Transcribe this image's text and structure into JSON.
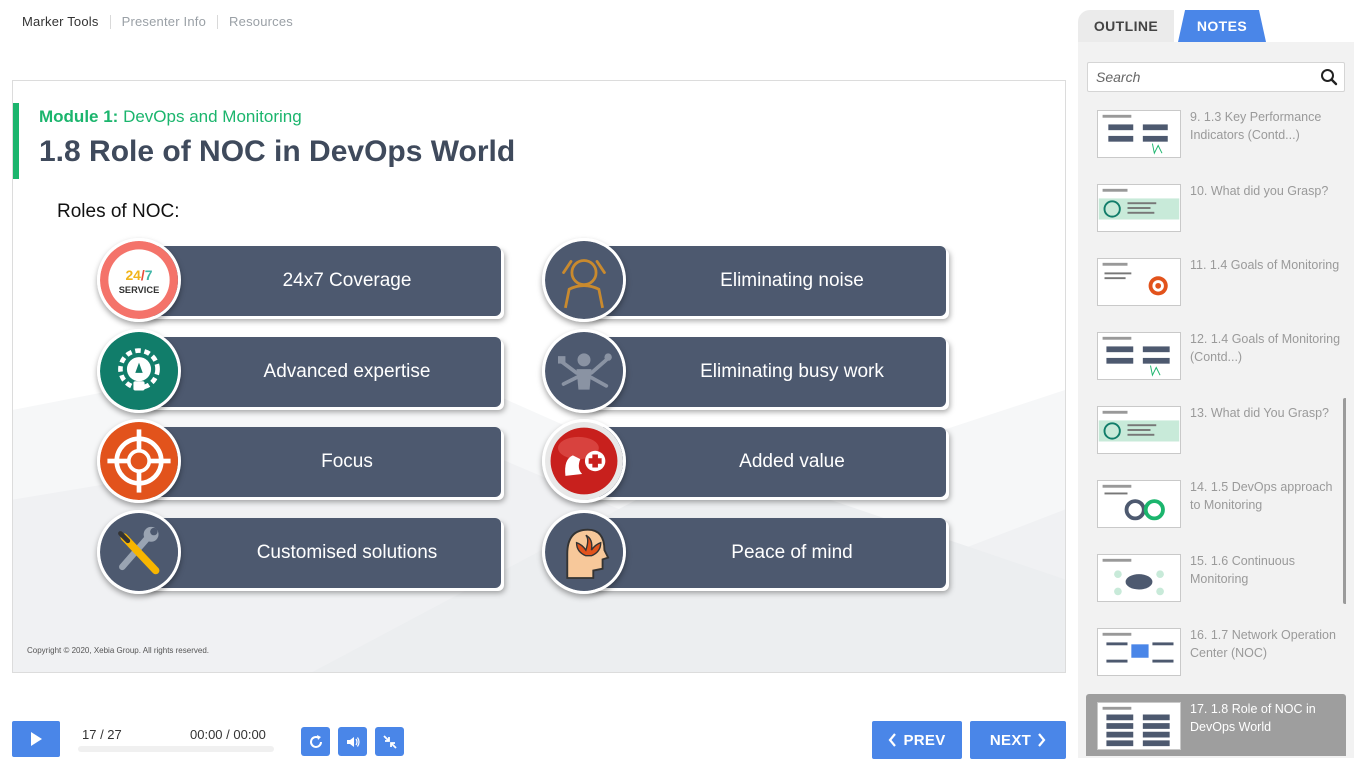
{
  "topnav": {
    "items": [
      "Marker Tools",
      "Presenter Info",
      "Resources"
    ]
  },
  "slide": {
    "module_label": "Module 1:",
    "module_name": "DevOps and Monitoring",
    "title": "1.8 Role of NOC in DevOps World",
    "subtitle": "Roles of NOC:",
    "roles": [
      {
        "label": "24x7 Coverage",
        "icon": "24-7-service-icon"
      },
      {
        "label": "Eliminating noise",
        "icon": "stressed-person-icon"
      },
      {
        "label": "Advanced expertise",
        "icon": "lightbulb-gear-icon"
      },
      {
        "label": "Eliminating busy work",
        "icon": "multitasking-person-icon"
      },
      {
        "label": "Focus",
        "icon": "target-icon"
      },
      {
        "label": "Added value",
        "icon": "hand-plus-icon"
      },
      {
        "label": "Customised solutions",
        "icon": "wrench-screwdriver-icon"
      },
      {
        "label": "Peace of mind",
        "icon": "lotus-head-icon"
      }
    ],
    "badge_text_top": "24/7",
    "badge_text_bottom": "SERVICE",
    "copyright": "Copyright © 2020, Xebia Group. All rights reserved."
  },
  "player": {
    "counter": "17 / 27",
    "time": "00:00 / 00:00",
    "progress": 0,
    "prev_label": "PREV",
    "next_label": "NEXT"
  },
  "sidebar": {
    "tabs": {
      "outline": "OUTLINE",
      "notes": "NOTES"
    },
    "active_tab": "NOTES",
    "search_placeholder": "Search",
    "items": [
      {
        "label": "9. 1.3 Key Performance Indicators (Contd...)"
      },
      {
        "label": "10. What did you Grasp?"
      },
      {
        "label": "11. 1.4 Goals of Monitoring"
      },
      {
        "label": "12. 1.4 Goals of Monitoring (Contd...)"
      },
      {
        "label": "13. What did You Grasp?"
      },
      {
        "label": "14. 1.5 DevOps approach to Monitoring"
      },
      {
        "label": "15. 1.6 Continuous Monitoring"
      },
      {
        "label": "16. 1.7 Network Operation Center (NOC)"
      },
      {
        "label": "17. 1.8 Role of NOC in DevOps World"
      }
    ],
    "active_item": 8
  },
  "colors": {
    "accent_blue": "#4a86e8",
    "module_green": "#1bb56d",
    "pill_slate": "#4d596f",
    "title_slate": "#3f4a5c"
  }
}
